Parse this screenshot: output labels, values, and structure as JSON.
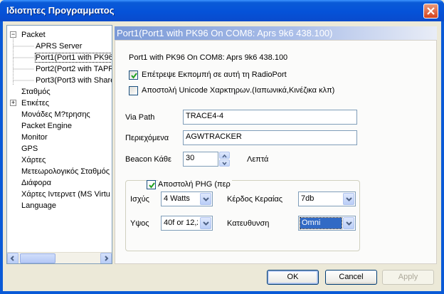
{
  "window": {
    "title": "Ιδιοτητες Προγραμματος"
  },
  "tree": {
    "items": [
      {
        "label": "Packet",
        "expander": "−"
      },
      {
        "label": "APRS Server"
      },
      {
        "label": "Port1(Port1 with PK96"
      },
      {
        "label": "Port2(Port2 with TAPR"
      },
      {
        "label": "Port3(Port3 with Share"
      },
      {
        "label": "Σταθμός"
      },
      {
        "label": "Ετικέτες",
        "expander": "+"
      },
      {
        "label": "Μονάδες Μ?τρησης"
      },
      {
        "label": "Packet Engine"
      },
      {
        "label": "Monitor"
      },
      {
        "label": "GPS"
      },
      {
        "label": "Χάρτες"
      },
      {
        "label": "Μετεωρολογικός Σταθμός"
      },
      {
        "label": "Διάφορα"
      },
      {
        "label": "Χάρτες Ιντερνετ (MS Virtu"
      },
      {
        "label": "Language"
      }
    ]
  },
  "panel": {
    "header": "Port1(Port1 with PK96 On COM8: Aprs 9k6 438.100)",
    "description": "Port1 with PK96 On COM8: Aprs 9k6 438.100",
    "allow_tx_label": "Επέτρεψε Εκπομπή σε αυτή τη RadioPort",
    "allow_tx_checked": true,
    "unicode_label": "Αποστολή Unicode Χαρκτηρων.(Ιαπωνικά,Κινέζικα κλπ)",
    "unicode_checked": false,
    "via_path_label": "Via Path",
    "via_path_value": "TRACE4-4",
    "content_label": "Περιεχόμενα",
    "content_value": "AGWTRACKER",
    "beacon_label": "Beacon Κάθε",
    "beacon_value": "30",
    "beacon_unit": "Λεπτά",
    "phg": {
      "label": "Αποστολή PHG (περ",
      "checked": true,
      "power_label": "Ισχύς",
      "power_value": "4 Watts",
      "gain_label": "Κέρδος Κεραίας",
      "gain_value": "7db",
      "height_label": "Υψος",
      "height_value": "40f or 12,2",
      "direction_label": "Κατευθυνση",
      "direction_value": "Omni"
    }
  },
  "buttons": {
    "ok": "OK",
    "cancel": "Cancel",
    "apply": "Apply"
  },
  "colors": {
    "title_bar": "#0a5ad7",
    "panel_header": "#7b9ad7",
    "selection": "#316ac5"
  }
}
